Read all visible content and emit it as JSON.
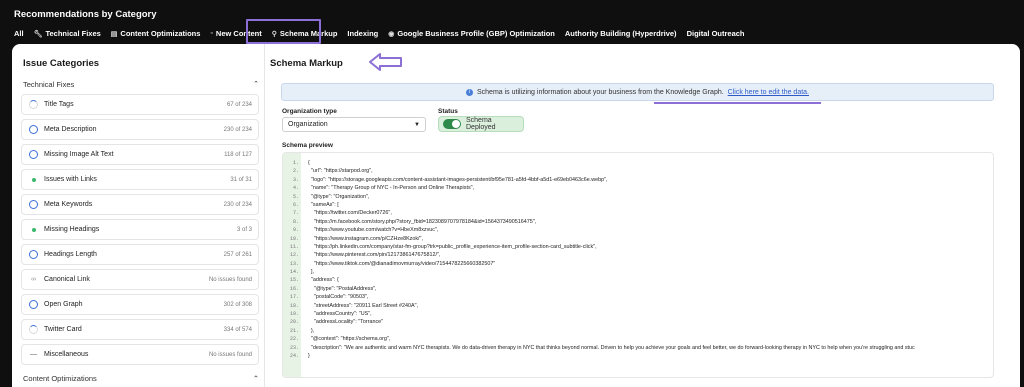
{
  "app_title": "Recommendations by Category",
  "tabs": [
    {
      "label": "All",
      "icon": ""
    },
    {
      "label": "Technical Fixes",
      "icon": "wrench-icon"
    },
    {
      "label": "Content Optimizations",
      "icon": "document-icon"
    },
    {
      "label": "New Content",
      "icon": "file-icon"
    },
    {
      "label": "Schema Markup",
      "icon": "search-icon"
    },
    {
      "label": "Indexing",
      "icon": ""
    },
    {
      "label": "Google Business Profile (GBP) Optimization",
      "icon": "pin-icon"
    },
    {
      "label": "Authority Building (Hyperdrive)",
      "icon": ""
    },
    {
      "label": "Digital Outreach",
      "icon": ""
    }
  ],
  "sidebar": {
    "title": "Issue Categories",
    "group1": "Technical Fixes",
    "group2": "Content Optimizations",
    "items": [
      {
        "label": "Title Tags",
        "count": "67 of 234",
        "status": "partial"
      },
      {
        "label": "Meta Description",
        "count": "230 of 234",
        "status": "ring"
      },
      {
        "label": "Missing Image Alt Text",
        "count": "118 of 127",
        "status": "ring"
      },
      {
        "label": "Issues with Links",
        "count": "31 of 31",
        "status": "dot"
      },
      {
        "label": "Meta Keywords",
        "count": "230 of 234",
        "status": "ring"
      },
      {
        "label": "Missing Headings",
        "count": "3 of 3",
        "status": "dot"
      },
      {
        "label": "Headings Length",
        "count": "257 of 261",
        "status": "ring"
      },
      {
        "label": "Canonical Link",
        "count": "No issues found",
        "status": "link"
      },
      {
        "label": "Open Graph",
        "count": "302 of 308",
        "status": "ring"
      },
      {
        "label": "Twitter Card",
        "count": "334 of 574",
        "status": "partial"
      },
      {
        "label": "Miscellaneous",
        "count": "No issues found",
        "status": "dash"
      }
    ]
  },
  "main": {
    "title": "Schema Markup",
    "info_text": "Schema is utilizing information about your business from the Knowledge Graph.",
    "info_link": "Click here to edit the data.",
    "org_type_label": "Organization type",
    "org_type_value": "Organization",
    "status_label": "Status",
    "status_value": "Schema Deployed",
    "preview_label": "Schema preview"
  },
  "schema_lines": [
    "{",
    "  \"url\": \"https://starpod.org\",",
    "  \"logo\": \"https://storage.googleapis.com/content-assistant-images-persistent/bf95e781-a5fd-4bbf-a5d1-e69eb0463c6e.webp\",",
    "  \"name\": \"Therapy Group of NYC - In-Person and Online Therapists\",",
    "  \"@type\": \"Organization\",",
    "  \"sameAs\": [",
    "    \"https://twitter.com/Decker0726\",",
    "    \"https://m.facebook.com/story.php/?story_fbid=1823089707978184&id=1564373490516475\",",
    "    \"https://www.youtube.com/watch?v=HbeXm8xzvuc\",",
    "    \"https://www.instagram.com/p/CZHze8Kzok/\",",
    "    \"https://ph.linkedin.com/company/star-fm-group?trk=public_profile_experience-item_profile-section-card_subtitle-click\",",
    "    \"https://www.pinterest.com/pin/1217386147675812/\",",
    "    \"https://www.tiktok.com/@dianadimovmurray/video/7154478225660382507\"",
    "  ],",
    "  \"address\": {",
    "    \"@type\": \"PostalAddress\",",
    "    \"postalCode\": \"90503\",",
    "    \"streetAddress\": \"20911 Earl Street #240A\",",
    "    \"addressCountry\": \"US\",",
    "    \"addressLocality\": \"Torrance\"",
    "  },",
    "  \"@context\": \"https://schema.org\",",
    "  \"description\": \"We are authentic and warm NYC therapists. We do data-driven therapy in NYC that thinks beyond normal. Driven to help you achieve your goals and feel better, we do forward-looking therapy in NYC to help when you're struggling and stuc",
    "}"
  ],
  "colors": {
    "accent": "#8b6fd6",
    "brand_green": "#2e8a4a",
    "link": "#2d5cc9"
  }
}
